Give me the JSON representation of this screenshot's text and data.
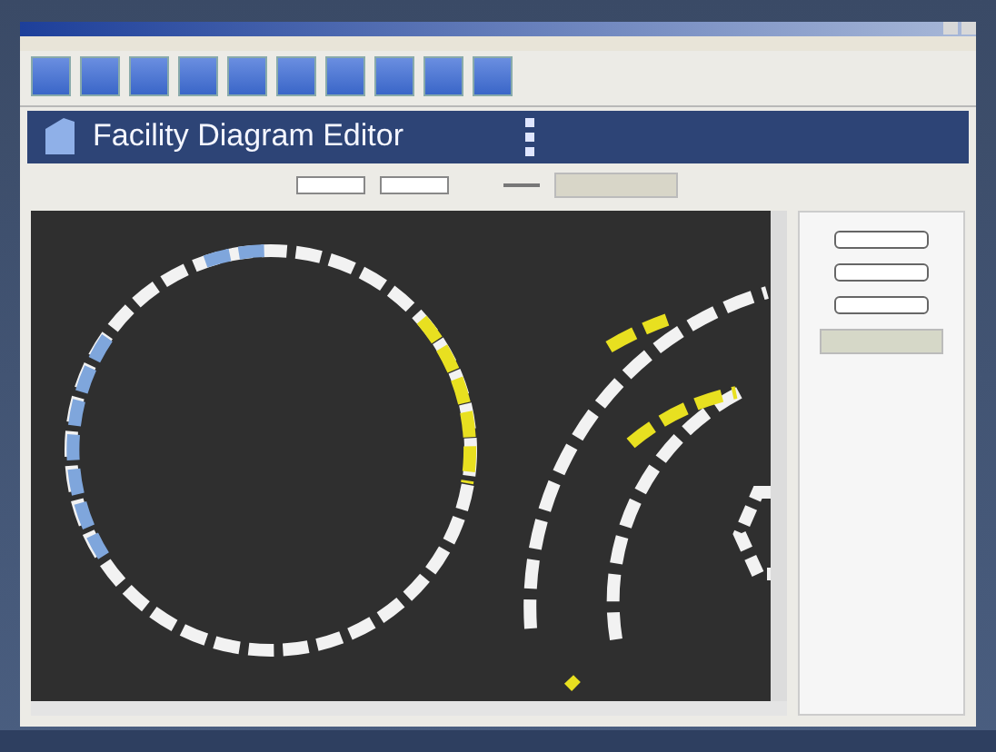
{
  "banner": {
    "title": "Facility Diagram Editor"
  }
}
